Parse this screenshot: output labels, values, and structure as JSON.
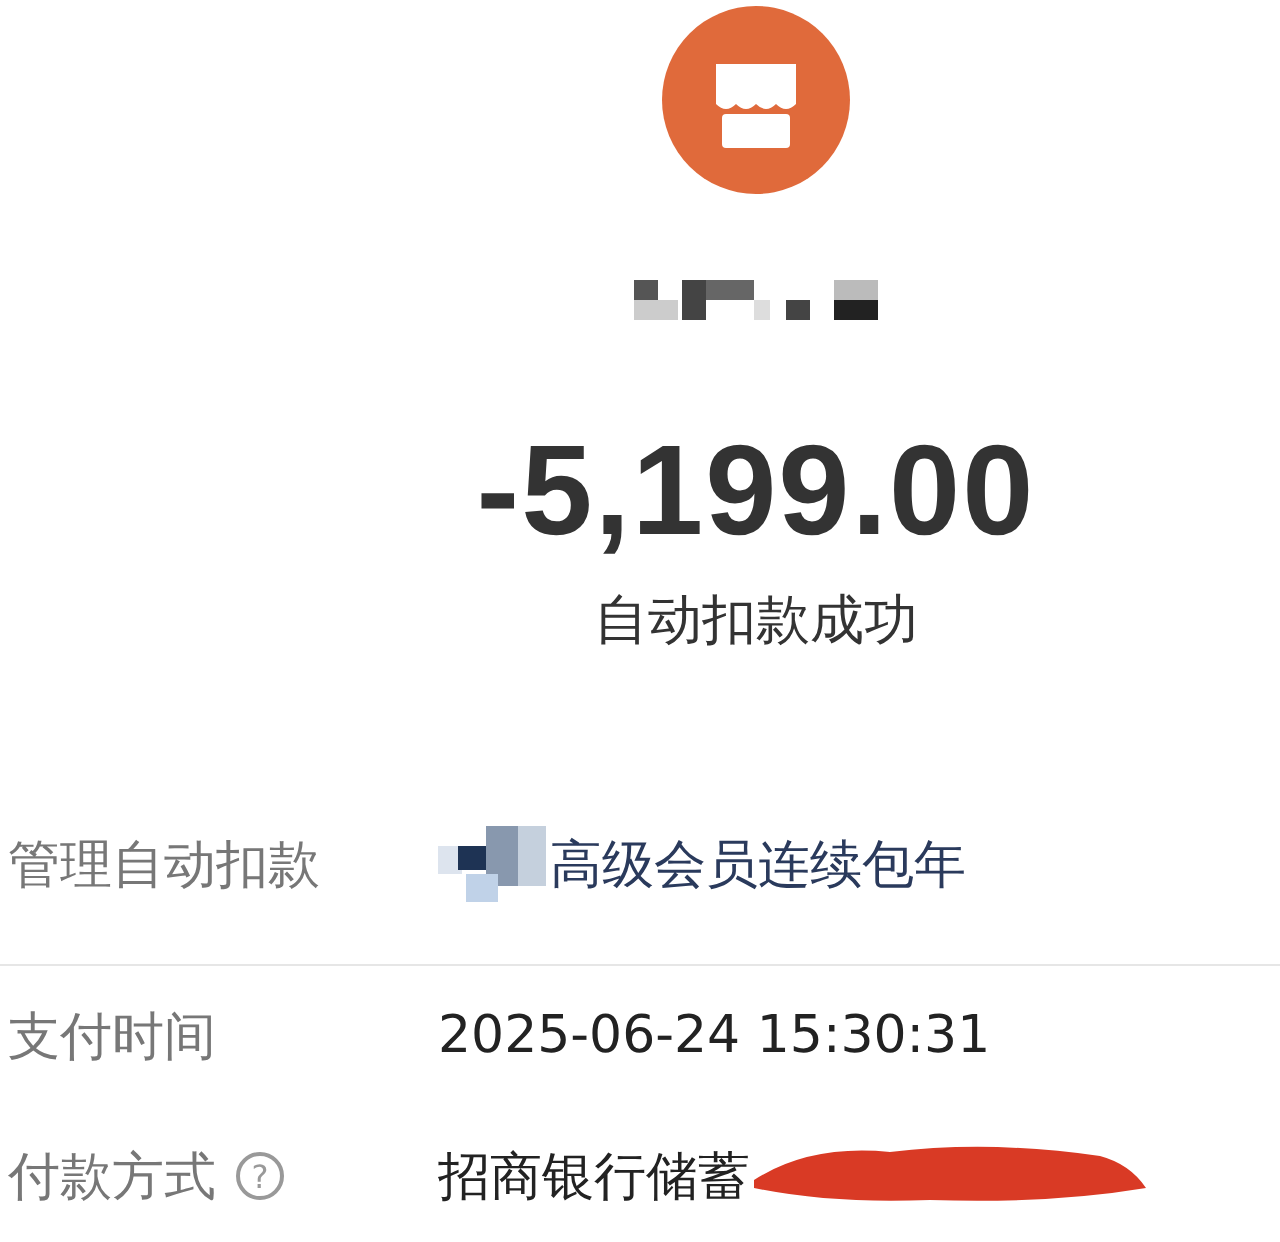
{
  "merchant": {
    "name_redacted": true
  },
  "amount": "-5,199.00",
  "status": "自动扣款成功",
  "rows": [
    {
      "label": "管理自动扣款",
      "value": "高级会员连续包年",
      "link": true,
      "prefix_redacted": true,
      "tail_redacted": false
    },
    {
      "label": "支付时间",
      "value": "2025-06-24 15:30:31",
      "link": false,
      "prefix_redacted": false,
      "tail_redacted": false
    },
    {
      "label": "付款方式",
      "value": "招商银行储蓄",
      "link": false,
      "help": "?",
      "prefix_redacted": false,
      "tail_redacted": true
    }
  ]
}
